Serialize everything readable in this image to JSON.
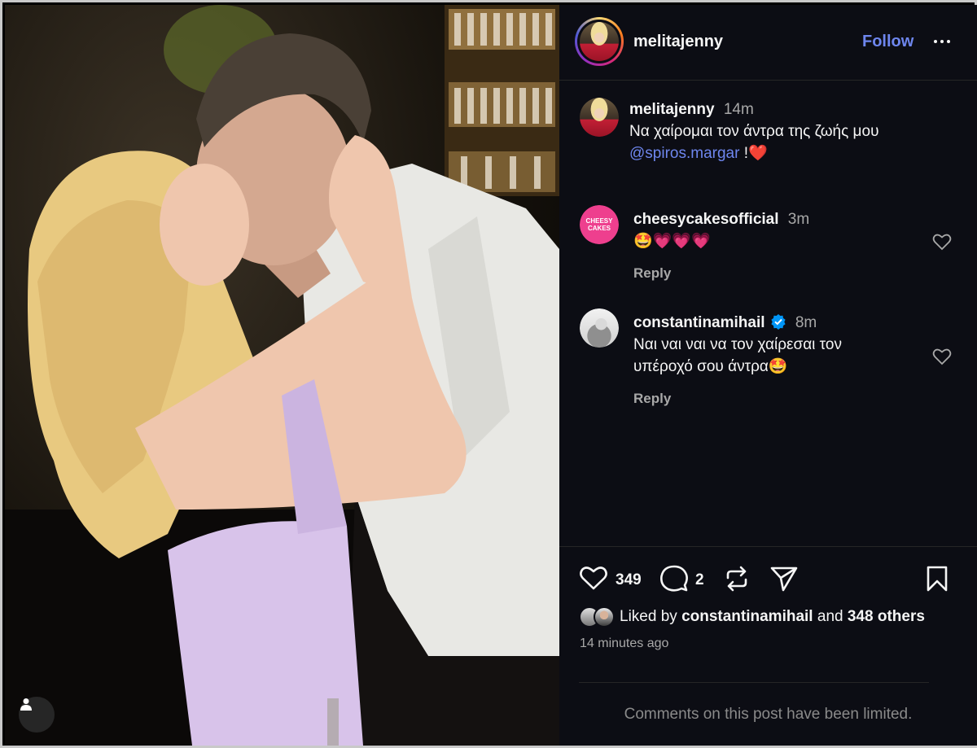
{
  "post": {
    "username": "melitajenny",
    "follow_label": "Follow",
    "caption": {
      "username": "melitajenny",
      "time": "14m",
      "text": "Να χαίρομαι τον άντρα της ζωής μου",
      "mention": "@spiros.margar",
      "suffix": " !❤️"
    }
  },
  "comments": [
    {
      "username": "cheesycakesofficial",
      "time": "3m",
      "text": "🤩💗💗💗",
      "reply_label": "Reply",
      "avatar_text": "CHEESY CAKES"
    },
    {
      "username": "constantinamihail",
      "verified": true,
      "time": "8m",
      "text_line1": "Ναι ναι ναι να τον χαίρεσαι τον",
      "text_line2": "υπέροχό σου άντρα🤩",
      "reply_label": "Reply"
    }
  ],
  "actions": {
    "like_count": "349",
    "comment_count": "2"
  },
  "likes": {
    "prefix": "Liked by",
    "user": "constantinamihail",
    "and": "and",
    "others": "348 others"
  },
  "timestamp": "14 minutes ago",
  "limited_notice": "Comments on this post have been limited.",
  "colors": {
    "panel_bg": "#0c0d14",
    "accent_blue": "#6e86ee",
    "heart_red": "#ff3040",
    "verified_blue": "#0095f6"
  }
}
